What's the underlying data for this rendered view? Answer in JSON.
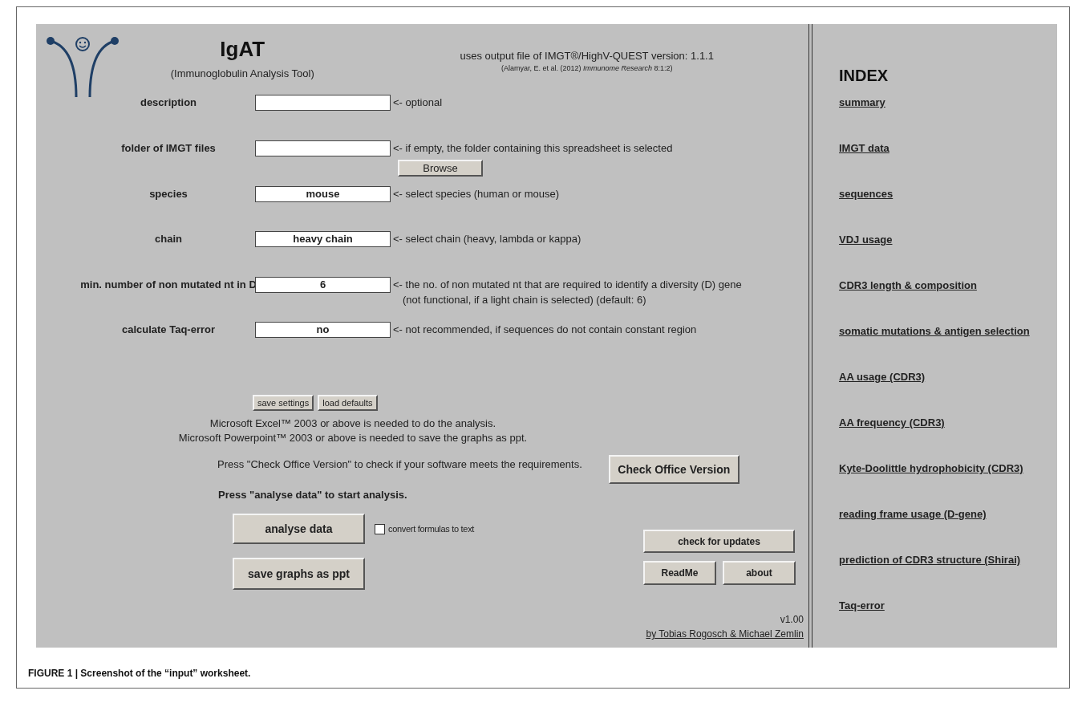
{
  "header": {
    "title": "IgAT",
    "subtitle": "(Immunoglobulin Analysis Tool)",
    "version_note": "uses output file of IMGT®/HighV-QUEST version: 1.1.1",
    "citation": "(Alamyar, E. et al. (2012) *Immunome Research* 8:1:2)"
  },
  "settings": [
    {
      "label": "description",
      "hint": "<- optional"
    },
    {
      "label": "folder of IMGT files",
      "hint": "<- if empty, the folder containing this spreadsheet is selected",
      "button": "Browse"
    },
    {
      "label": "species",
      "value": "mouse",
      "hint": "<- select species (human or mouse)"
    },
    {
      "label": "chain",
      "value": "heavy chain",
      "hint": "<- select chain (heavy, lambda or kappa)"
    },
    {
      "label": "min. number of non mutated nt in D",
      "value": "6",
      "hint": "<- the no. of non mutated nt that are required to identify a diversity (D) gene",
      "hint_note": "(not functional, if a light chain is selected) (default: 6)"
    },
    {
      "label": "calculate Taq-error",
      "value": "no",
      "hint": "<- not recommended, if sequences do not contain constant region"
    }
  ],
  "settings_buttons": [
    "save settings",
    "load defaults"
  ],
  "requirements": [
    "Microsoft Excel™ 2003 or above is needed to do the analysis.",
    "Microsoft Powerpoint™ 2003 or above is needed to save the graphs as ppt."
  ],
  "office_check": {
    "text": "Press \"Check Office Version\" to check if your software meets the requirements.",
    "button": "Check Office Version"
  },
  "analysis": {
    "instruction": "Press \"analyse data\" to start analysis.",
    "button": "analyse data",
    "convert_checkbox": {
      "label": "convert formulas to text",
      "checked": false
    },
    "save_button": "save graphs as ppt"
  },
  "info_buttons": {
    "updates": "check for updates",
    "readme": "ReadMe",
    "about": "about"
  },
  "version": "v1.00",
  "credits": "by Tobias Rogosch & Michael Zemlin",
  "index": {
    "title": "INDEX",
    "links": [
      "summary",
      "IMGT data",
      "sequences",
      "VDJ usage",
      "CDR3 length & composition",
      "somatic mutations & antigen selection",
      "AA usage (CDR3)",
      "AA frequency (CDR3)",
      "Kyte-Doolittle hydrophobicity (CDR3)",
      "reading frame usage (D-gene)",
      "prediction of CDR3 structure (Shirai)",
      "Taq-error"
    ]
  },
  "caption": "FIGURE 1 | Screenshot of the “input” worksheet."
}
